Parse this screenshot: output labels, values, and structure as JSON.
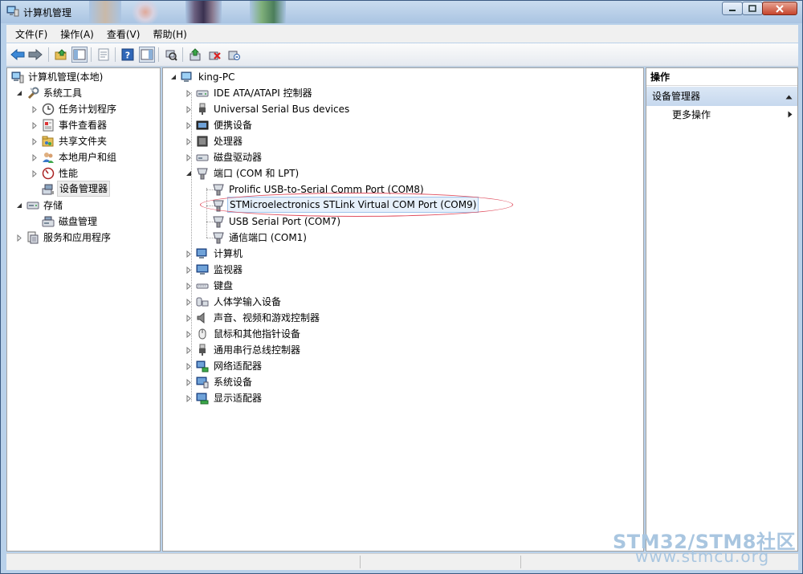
{
  "window": {
    "title": "计算机管理",
    "buttons": [
      "minimize",
      "maximize",
      "close"
    ]
  },
  "menu": [
    "文件(F)",
    "操作(A)",
    "查看(V)",
    "帮助(H)"
  ],
  "toolbar_icons": [
    "back-icon",
    "forward-icon",
    "up-folder-icon",
    "show-hide-tree-icon",
    "properties-icon",
    "help-icon",
    "show-action-pane-icon",
    "scan-hardware-icon",
    "update-driver-icon",
    "disable-device-icon",
    "uninstall-device-icon"
  ],
  "left_tree": {
    "root": "计算机管理(本地)",
    "items": [
      {
        "label": "系统工具",
        "expanded": true
      },
      {
        "label": "任务计划程序"
      },
      {
        "label": "事件查看器"
      },
      {
        "label": "共享文件夹"
      },
      {
        "label": "本地用户和组"
      },
      {
        "label": "性能"
      },
      {
        "label": "设备管理器",
        "selected": true
      },
      {
        "label": "存储",
        "expanded": true
      },
      {
        "label": "磁盘管理"
      },
      {
        "label": "服务和应用程序"
      }
    ]
  },
  "device_tree": {
    "root": "king-PC",
    "categories": [
      "IDE ATA/ATAPI 控制器",
      "Universal Serial Bus devices",
      "便携设备",
      "处理器",
      "磁盘驱动器",
      "端口 (COM 和 LPT)",
      "计算机",
      "监视器",
      "键盘",
      "人体学输入设备",
      "声音、视频和游戏控制器",
      "鼠标和其他指针设备",
      "通用串行总线控制器",
      "网络适配器",
      "系统设备",
      "显示适配器"
    ],
    "ports": [
      "Prolific USB-to-Serial Comm Port (COM8)",
      "STMicroelectronics STLink Virtual COM Port (COM9)",
      "USB Serial Port (COM7)",
      "通信端口 (COM1)"
    ],
    "selected_port": "STMicroelectronics STLink Virtual COM Port (COM9)"
  },
  "actions": {
    "header": "操作",
    "section": "设备管理器",
    "more": "更多操作"
  },
  "watermark": {
    "line1": "STM32/STM8社区",
    "line2": "www.stmcu.org"
  },
  "colors": {
    "highlight_ellipse": "#e05060",
    "selection": "#e6f0fb",
    "window_frame": "#b9d1ea"
  }
}
